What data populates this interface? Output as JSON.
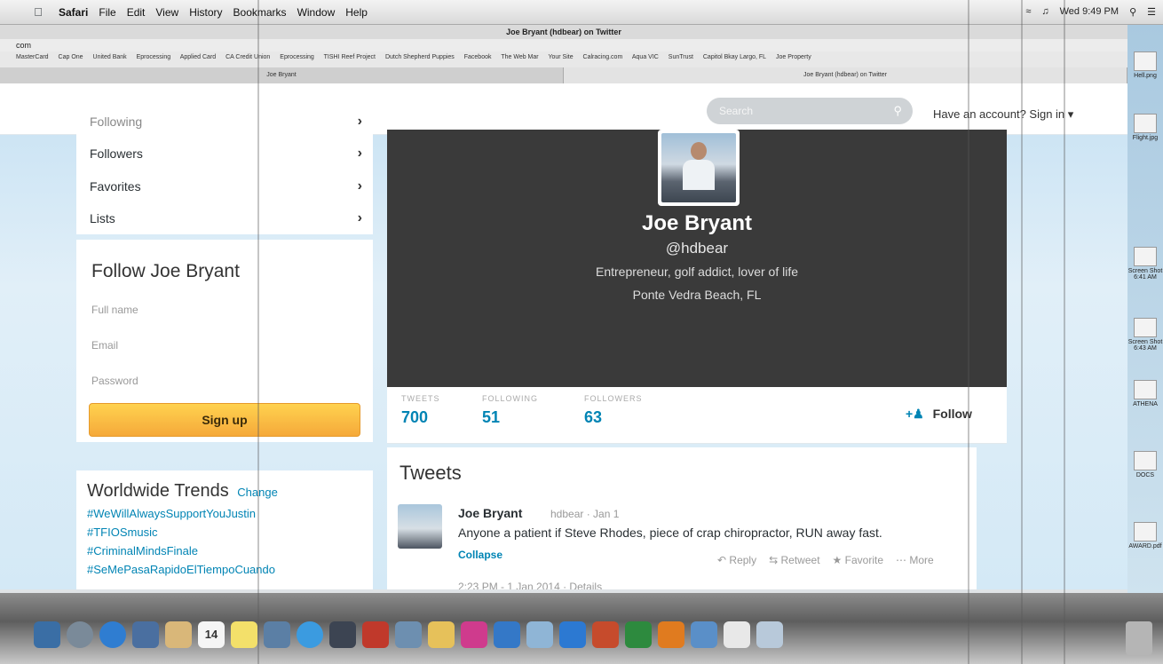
{
  "menubar": {
    "items": [
      "Safari",
      "File",
      "Edit",
      "View",
      "History",
      "Bookmarks",
      "Window",
      "Help"
    ],
    "clock": "Wed 9:49 PM"
  },
  "safari": {
    "window_title": "Joe Bryant (hdbear) on Twitter",
    "url_fragment": "com",
    "bookmarks": [
      "MasterCard",
      "Cap One",
      "United Bank",
      "Eprocessing",
      "Applied Card",
      "CA Credit Union",
      "Eprocessing",
      "TISHI Reef Project",
      "Dutch Shepherd Puppies",
      "Facebook",
      "The Web Mar",
      "Your Site",
      "Calracing.com",
      "Aqua VIC",
      "SunTrust",
      "Capitol Bkay Largo, FL",
      "Joe Property"
    ],
    "tabs": [
      "Joe Bryant",
      "Joe Bryant (hdbear) on Twitter"
    ]
  },
  "twitter": {
    "header": {
      "search_placeholder": "Search",
      "account_prompt": "Have an account? Sign in ▾"
    },
    "nav": {
      "cut_item": "Following",
      "items": [
        "Followers",
        "Favorites",
        "Lists"
      ]
    },
    "follow_card": {
      "title": "Follow Joe Bryant",
      "full_name_placeholder": "Full name",
      "email_placeholder": "Email",
      "password_placeholder": "Password",
      "signup_label": "Sign up"
    },
    "trends": {
      "title": "Worldwide Trends",
      "change_label": "Change",
      "items": [
        "#WeWillAlwaysSupportYouJustin",
        "#TFIOSmusic",
        "#CriminalMindsFinale",
        "#SeMePasaRapidoElTiempoCuando"
      ]
    },
    "profile": {
      "name": "Joe Bryant",
      "handle": "@hdbear",
      "bio": "Entrepreneur, golf addict, lover of life",
      "location": "Ponte Vedra Beach, FL"
    },
    "stats": {
      "tweets_label": "TWEETS",
      "tweets_value": "700",
      "following_label": "FOLLOWING",
      "following_value": "51",
      "followers_label": "FOLLOWERS",
      "followers_value": "63",
      "follow_label": "Follow"
    },
    "tweets_section": {
      "title": "Tweets",
      "tweet": {
        "name": "Joe Bryant",
        "meta": "hdbear · Jan 1",
        "text": "Anyone a patient if Steve Rhodes, piece of crap chiropractor, RUN away fast.",
        "collapse_label": "Collapse",
        "reply_label": "Reply",
        "retweet_label": "Retweet",
        "favorite_label": "Favorite",
        "more_label": "More",
        "details": "2:23 PM - 1 Jan 2014 · Details"
      }
    }
  },
  "desktop_files": [
    "Hell.png",
    "Flight.jpg",
    "Screen Shot 6:41 AM",
    "Screen Shot 6:43 AM",
    "ATHENA",
    "DOCS",
    "AWARD.pdf"
  ],
  "dock": {
    "calendar_day": "14"
  },
  "colors": {
    "twitter_link": "#0084b4",
    "signup_button": "#f5a93a",
    "profile_banner": "#3a3a3a"
  }
}
